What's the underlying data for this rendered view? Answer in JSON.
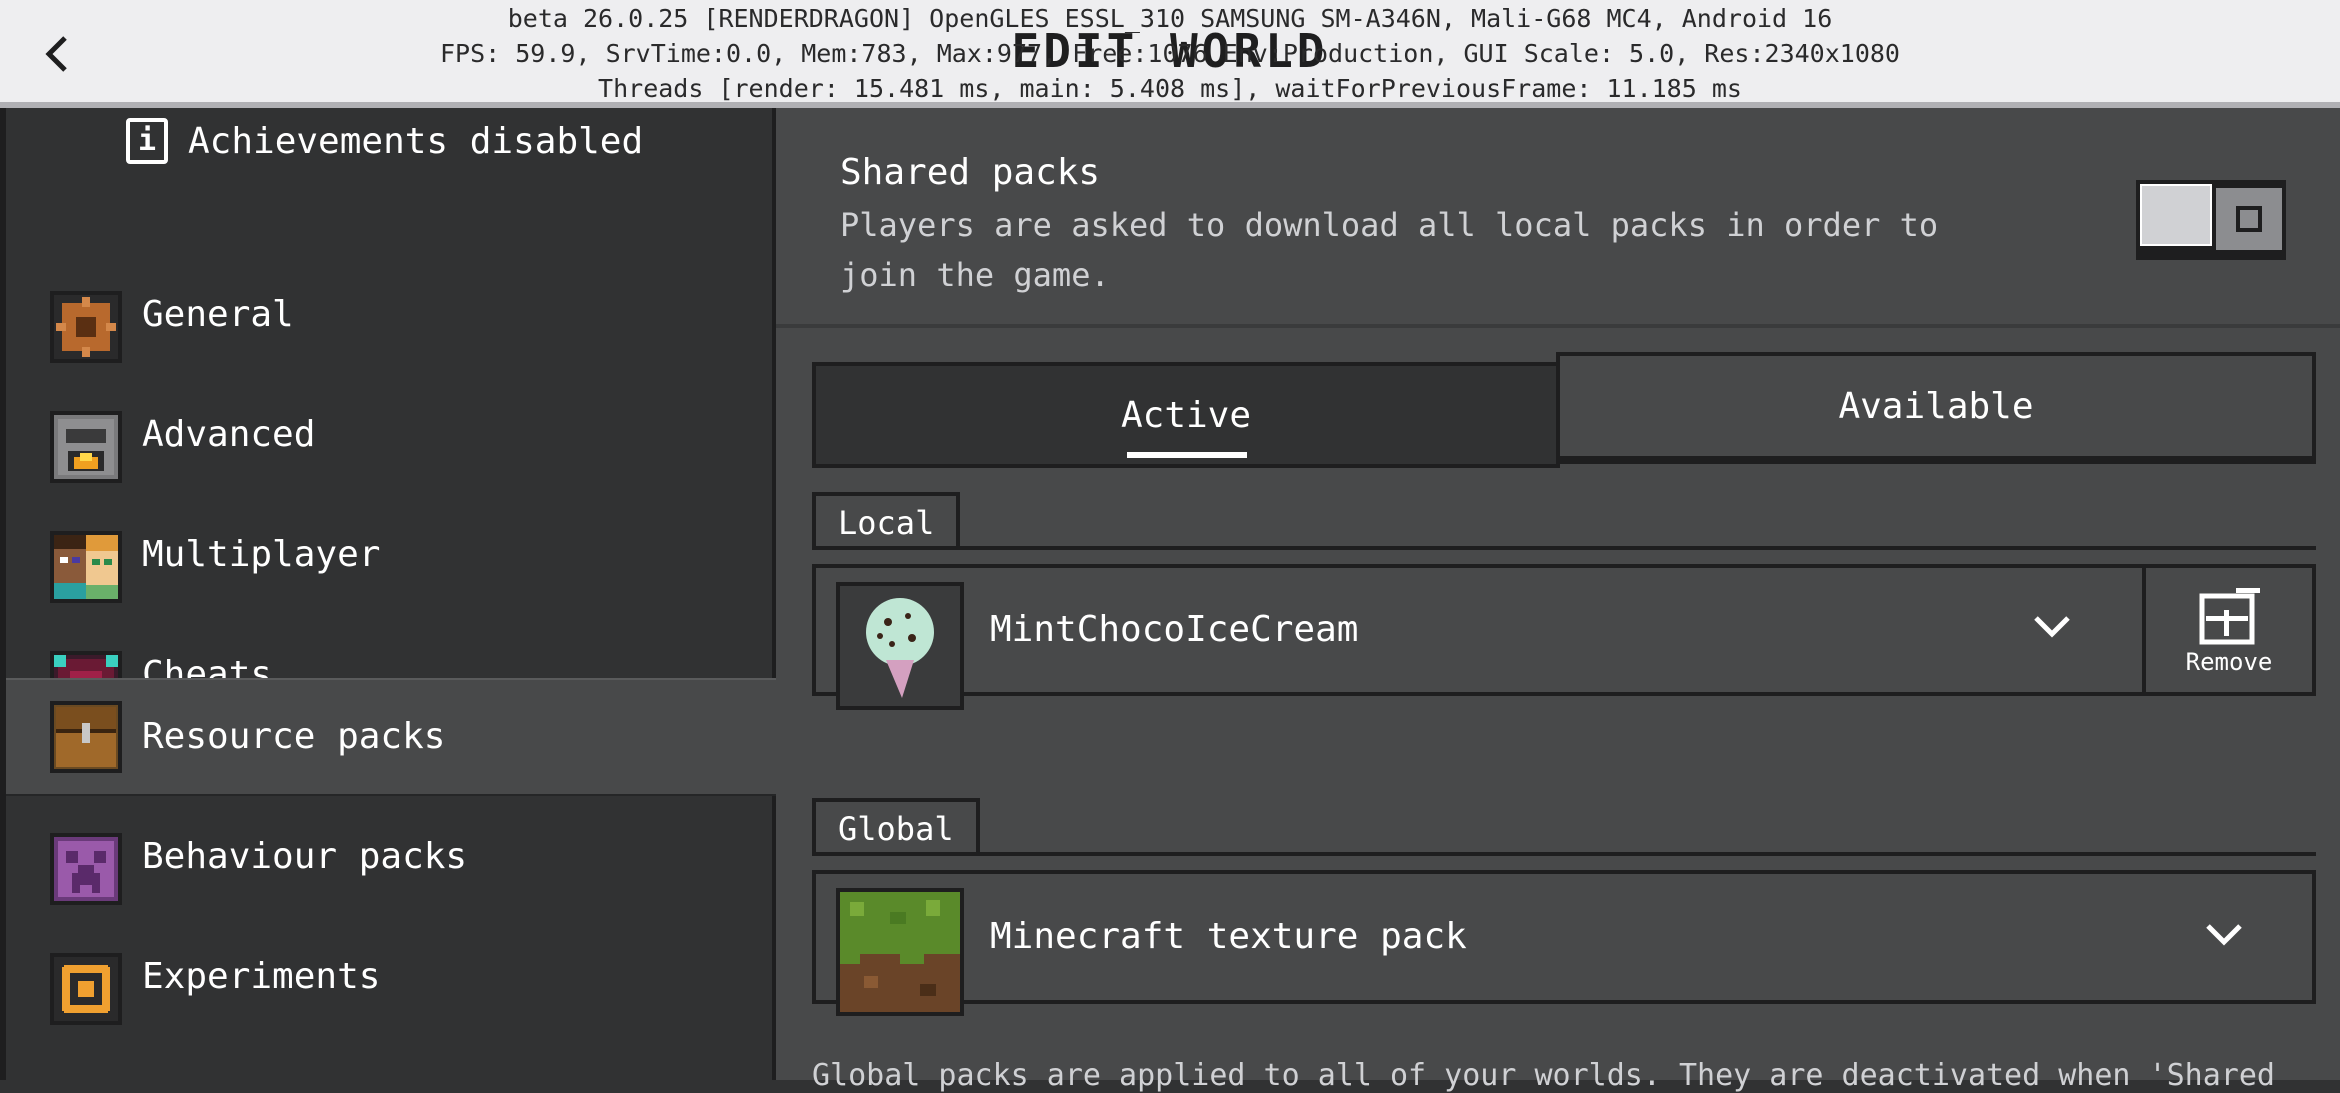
{
  "topbar": {
    "title": "EDIT WORLD",
    "debug_lines": [
      "beta 26.0.25 [RENDERDRAGON] OpenGLES ESSL_310 SAMSUNG SM-A346N, Mali-G68 MC4, Android 16",
      "FPS: 59.9, SrvTime:0.0, Mem:783, Max:977, Free:1076 Env:Production, GUI Scale: 5.0, Res:2340x1080",
      "Threads [render: 15.481 ms, main: 5.408 ms], waitForPreviousFrame: 11.185 ms"
    ]
  },
  "sidebar": {
    "achievements": "Achievements disabled",
    "items": [
      {
        "label": "General",
        "icon": "gear-icon"
      },
      {
        "label": "Advanced",
        "icon": "furnace-icon"
      },
      {
        "label": "Multiplayer",
        "icon": "players-icon"
      },
      {
        "label": "Cheats",
        "icon": "command-block-icon"
      },
      {
        "label": "Resource packs",
        "icon": "chest-icon",
        "selected": true
      },
      {
        "label": "Behaviour packs",
        "icon": "creeper-icon"
      },
      {
        "label": "Experiments",
        "icon": "experiment-icon"
      }
    ]
  },
  "main": {
    "shared_packs": {
      "title": "Shared packs",
      "description": "Players are asked to download all local packs in order to join the game.",
      "enabled": false
    },
    "tabs": [
      {
        "label": "Active",
        "selected": true
      },
      {
        "label": "Available",
        "selected": false
      }
    ],
    "local": {
      "header": "Local",
      "packs": [
        {
          "name": "MintChocoIceCream",
          "action": "Remove"
        }
      ]
    },
    "global": {
      "header": "Global",
      "packs": [
        {
          "name": "Minecraft texture pack"
        }
      ],
      "note": "Global packs are applied to all of your worlds. They are deactivated when 'Shared"
    }
  },
  "colors": {
    "background": "#313233",
    "panel": "#48494a",
    "border": "#1e1e1f",
    "topbar": "#eeeef0"
  }
}
